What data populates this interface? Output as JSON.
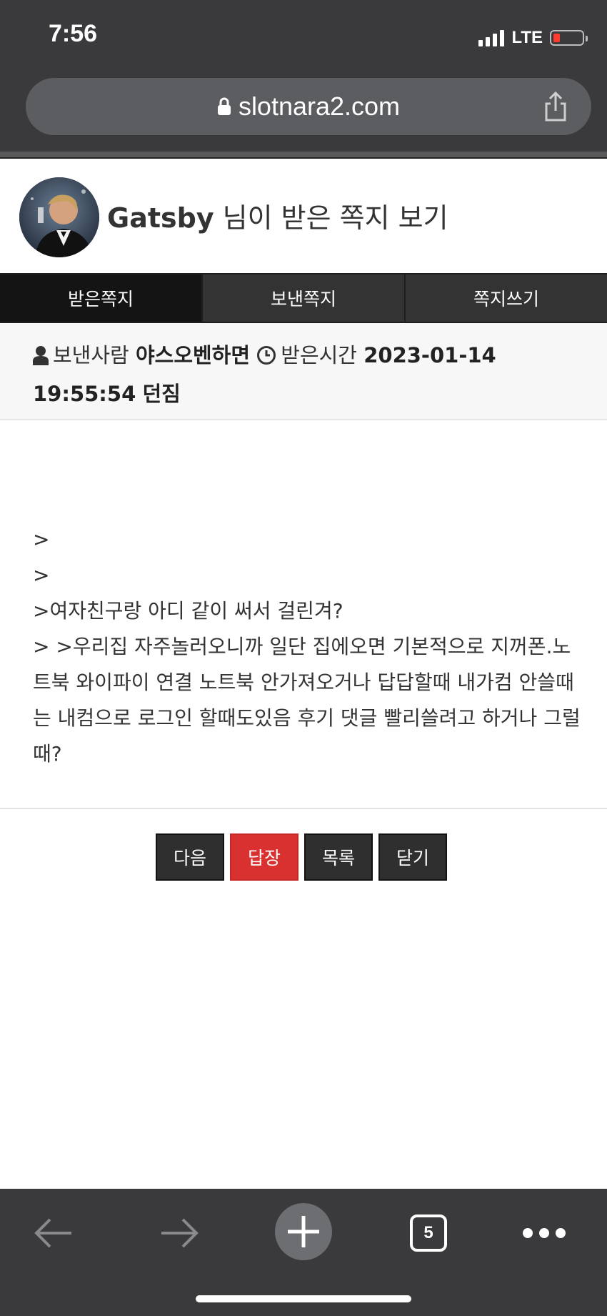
{
  "status_bar": {
    "time": "7:56",
    "network": "LTE"
  },
  "browser": {
    "url": "slotnara2.com",
    "tab_count": "5"
  },
  "header": {
    "user_name": "Gatsby",
    "title_suffix": " 님이 받은 쪽지 보기"
  },
  "tabs": [
    {
      "label": "받은쪽지"
    },
    {
      "label": "보낸쪽지"
    },
    {
      "label": "쪽지쓰기"
    }
  ],
  "info": {
    "sender_label": "보낸사람",
    "sender_name": "야스오벤하면",
    "received_label": "받은시간",
    "received_time": "2023-01-14 19:55:54",
    "extra": "던짐"
  },
  "message": {
    "lines": [
      " >",
      " >",
      " >여자친구랑 아디 같이 써서 걸린겨?",
      " > >우리집 자주놀러오니까 일단 집에오면 기본적으로 지꺼폰.노트북 와이파이 연결 노트북 안가져오거나 답답할때 내가컴 안쓸때는 내컴으로 로그인 할때도있음 후기 댓글 빨리쓸려고 하거나 그럴때?"
    ]
  },
  "buttons": {
    "next": "다음",
    "reply": "답장",
    "list": "목록",
    "close": "닫기"
  },
  "colors": {
    "reply_button": "#d9312f",
    "chrome": "#3a3a3c"
  }
}
